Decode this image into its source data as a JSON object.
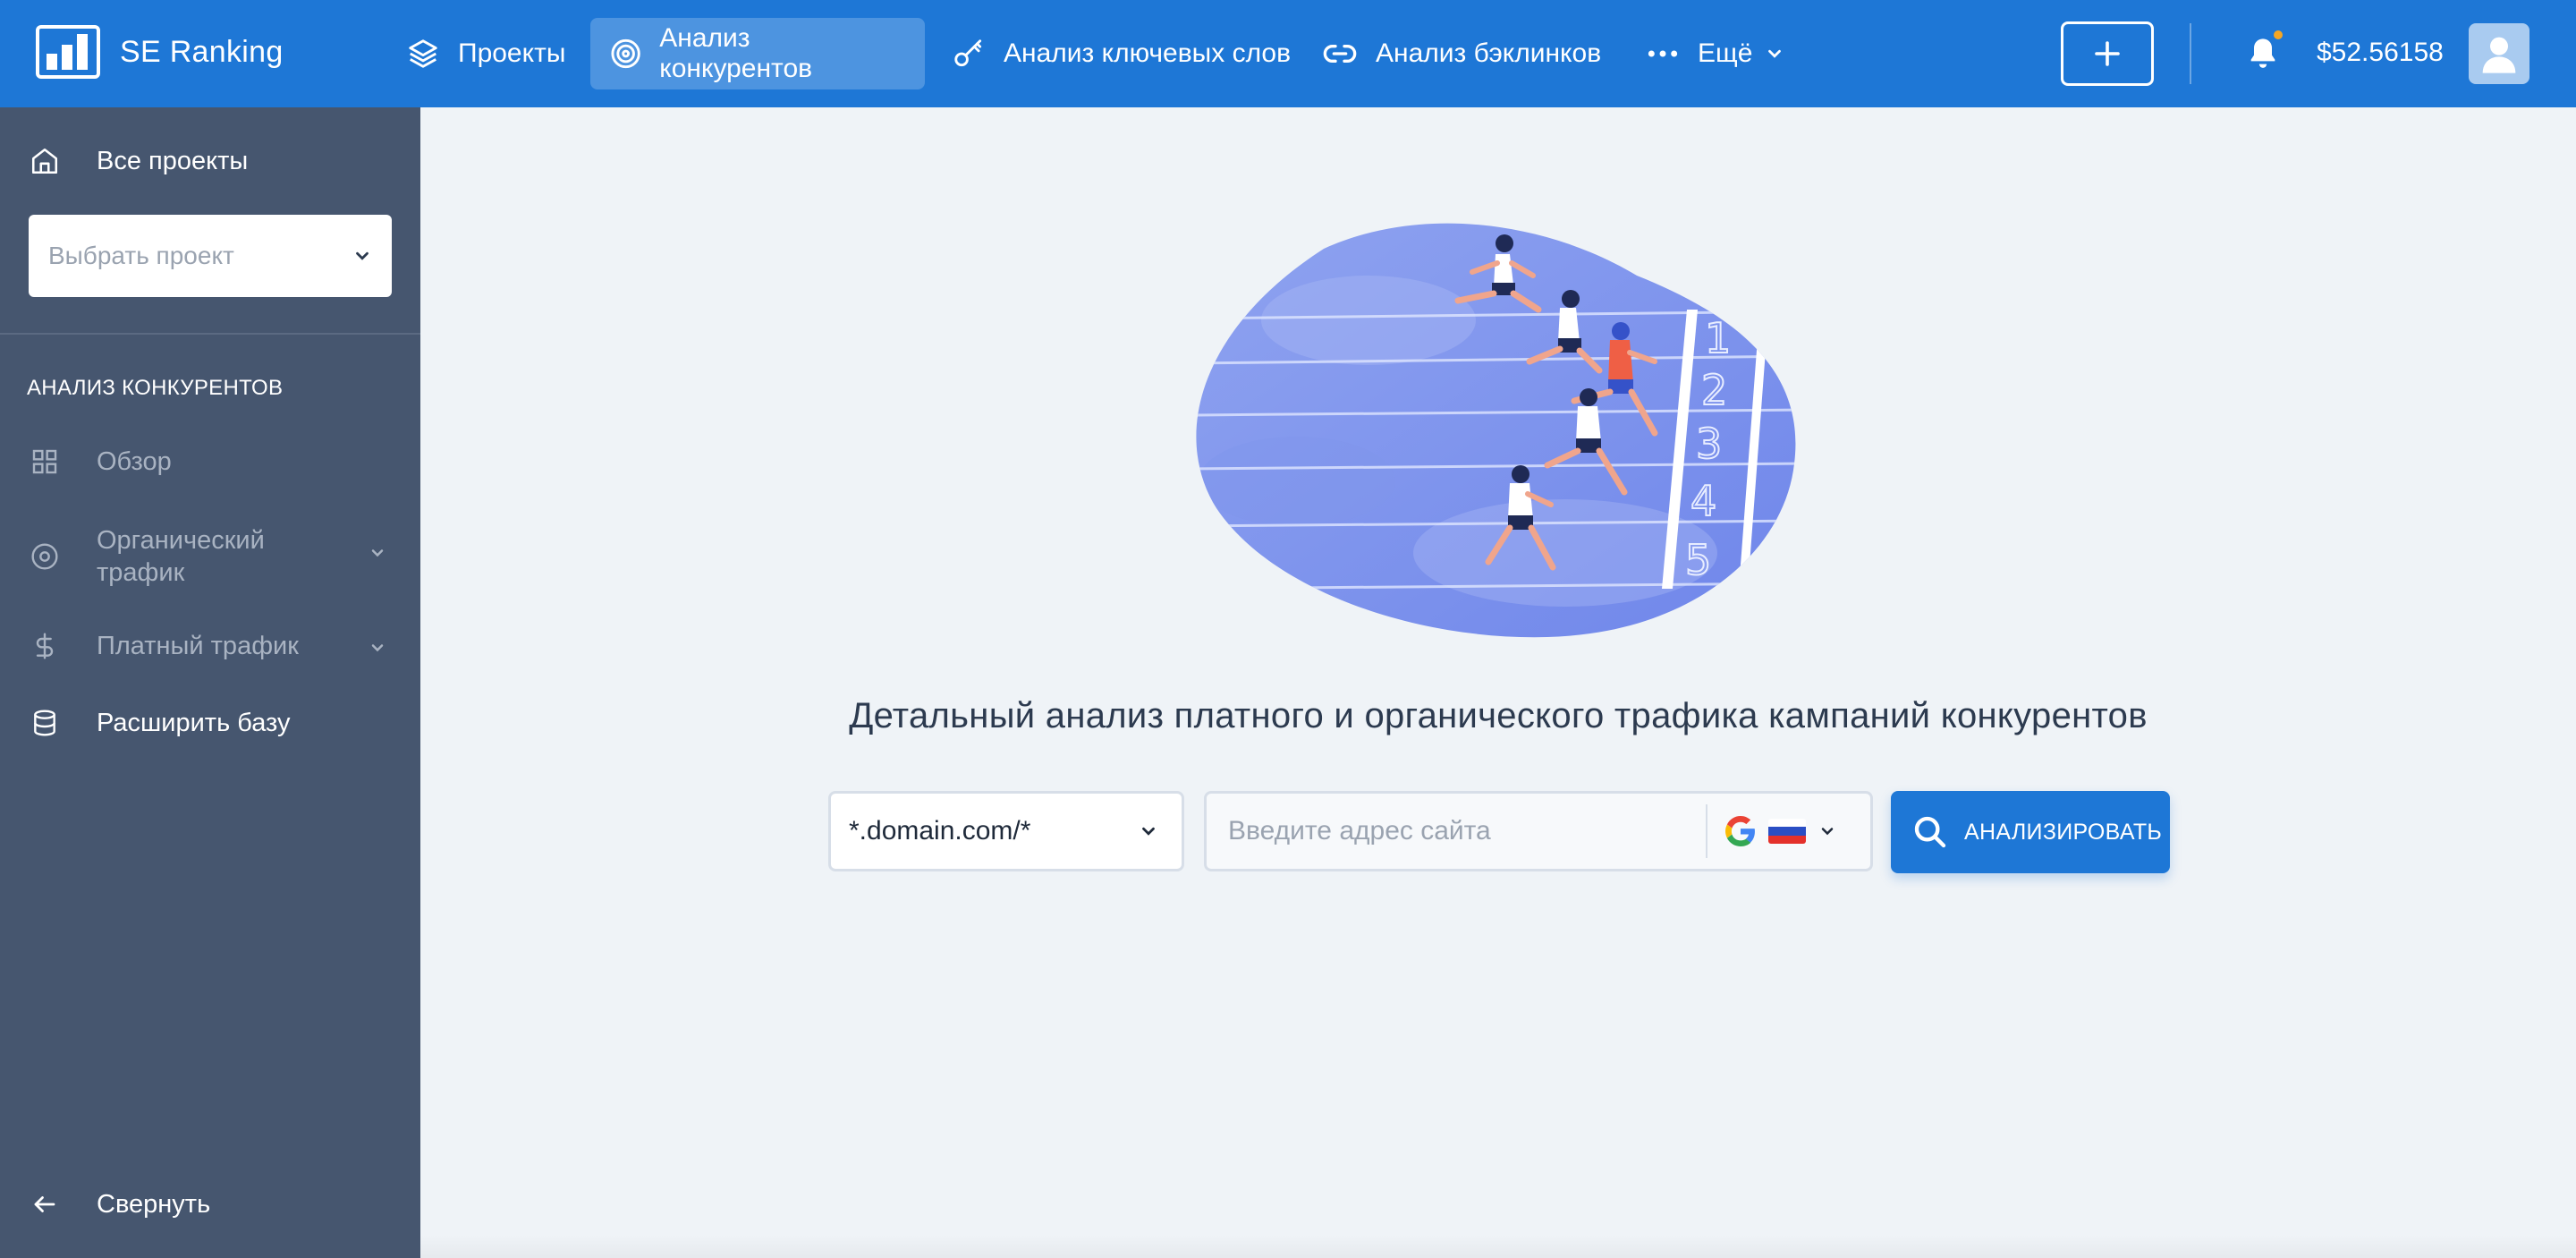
{
  "app": {
    "name": "SE Ranking",
    "balance": "$52.56158"
  },
  "nav": {
    "items": [
      {
        "label": "Проекты",
        "icon": "layers-icon"
      },
      {
        "label": "Анализ конкурентов",
        "icon": "target-icon",
        "active": true
      },
      {
        "label": "Анализ ключевых слов",
        "icon": "key-icon"
      },
      {
        "label": "Анализ бэклинков",
        "icon": "link-icon"
      },
      {
        "label": "Ещё",
        "icon": "more-dots-icon"
      }
    ]
  },
  "sidebar": {
    "all_projects": "Все проекты",
    "project_select_placeholder": "Выбрать проект",
    "section_title": "АНАЛИЗ КОНКУРЕНТОВ",
    "items": [
      {
        "label": "Обзор",
        "icon": "grid-icon"
      },
      {
        "label": "Органический\nтрафик",
        "icon": "circle-target-icon"
      },
      {
        "label": "Платный трафик",
        "icon": "dollar-icon"
      },
      {
        "label": "Расширить базу",
        "icon": "database-icon"
      }
    ],
    "collapse": "Свернуть"
  },
  "main": {
    "headline": "Детальный анализ платного и органического трафика кампаний конкурентов",
    "domain_mode": "*.domain.com/*",
    "url_placeholder": "Введите адрес сайта",
    "search_engine": "google-icon",
    "region": "russia-flag",
    "analyze_button": "АНАЛИЗИРОВАТЬ"
  },
  "colors": {
    "brand_blue": "#1e77d6",
    "active_tab": "#4d94e0",
    "sidebar_bg": "#46566f",
    "page_bg": "#eff3f7",
    "notification_dot": "#f5a623"
  }
}
